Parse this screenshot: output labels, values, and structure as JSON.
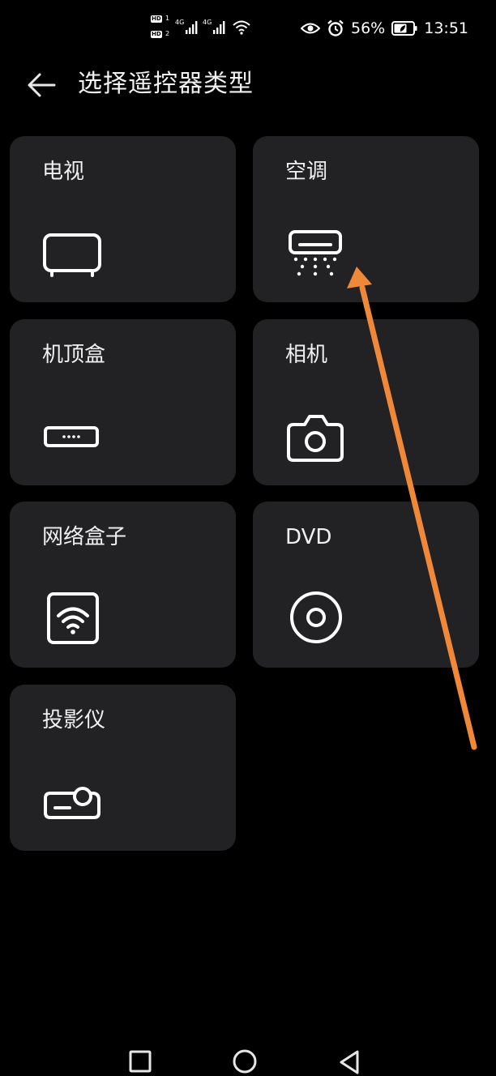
{
  "status_bar": {
    "hd1": "HD",
    "hd1_sub": "1",
    "hd2": "HD",
    "hd2_sub": "2",
    "net1": "4G",
    "net2": "4G",
    "battery": "56%",
    "time": "13:51",
    "icons": [
      "signal-icon",
      "signal-icon",
      "wifi-icon",
      "eye-icon",
      "alarm-icon",
      "battery-icon"
    ]
  },
  "header": {
    "title": "选择遥控器类型",
    "back_icon": "back-arrow-icon"
  },
  "devices": [
    {
      "label": "电视",
      "icon": "tv-icon"
    },
    {
      "label": "空调",
      "icon": "air-conditioner-icon"
    },
    {
      "label": "机顶盒",
      "icon": "set-top-box-icon"
    },
    {
      "label": "相机",
      "icon": "camera-icon"
    },
    {
      "label": "网络盒子",
      "icon": "network-box-icon"
    },
    {
      "label": "DVD",
      "icon": "dvd-icon"
    },
    {
      "label": "投影仪",
      "icon": "projector-icon"
    }
  ],
  "annotation": {
    "color": "#f0883a"
  },
  "nav_bar": {
    "icons": [
      "recent-apps-icon",
      "home-icon",
      "back-icon"
    ]
  },
  "colors": {
    "background": "#000000",
    "card": "#222224",
    "text": "#f0f0f0"
  }
}
